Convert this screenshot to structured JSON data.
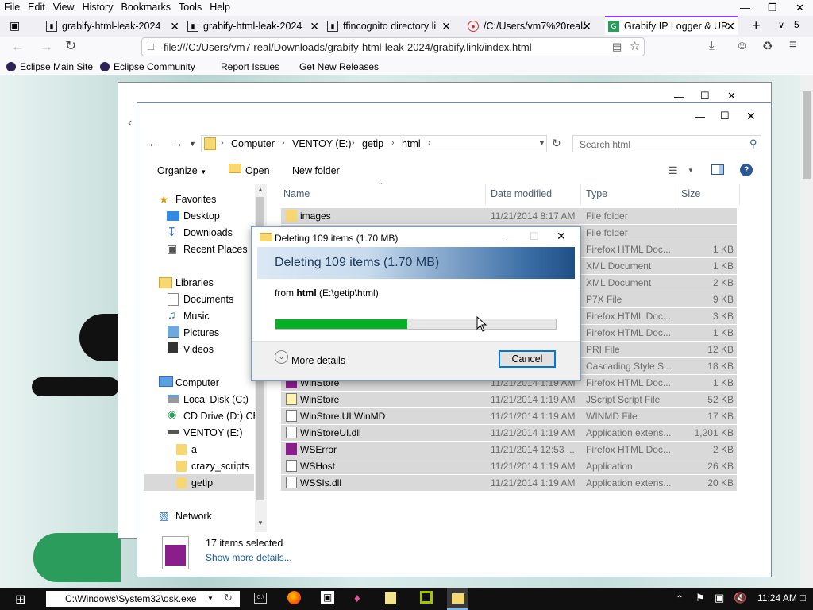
{
  "firefox": {
    "menu": [
      "File",
      "Edit",
      "View",
      "History",
      "Bookmarks",
      "Tools",
      "Help"
    ],
    "tabs": [
      {
        "title": "grabify-html-leak-2024"
      },
      {
        "title": "grabify-html-leak-2024"
      },
      {
        "title": "ffincognito directory li"
      },
      {
        "title": "/C:/Users/vm7%20real/"
      },
      {
        "title": "Grabify IP Logger & UR"
      }
    ],
    "tab_count": "5",
    "url": "file:///C:/Users/vm7 real/Downloads/grabify-html-leak-2024/grabify.link/index.html",
    "bookmarks": [
      "Eclipse Main Site",
      "Eclipse Community",
      "Report Issues",
      "Get New Releases"
    ],
    "accent": "#8f3cff"
  },
  "explorer": {
    "breadcrumb": [
      "Computer",
      "VENTOY (E:)",
      "getip",
      "html"
    ],
    "search_placeholder": "Search html",
    "toolbar": {
      "organize": "Organize",
      "open": "Open",
      "new_folder": "New folder"
    },
    "nav": {
      "favorites": "Favorites",
      "desktop": "Desktop",
      "downloads": "Downloads",
      "recent": "Recent Places",
      "libraries": "Libraries",
      "documents": "Documents",
      "music": "Music",
      "pictures": "Pictures",
      "videos": "Videos",
      "computer": "Computer",
      "local_disk": "Local Disk (C:)",
      "cd_drive": "CD Drive (D:) CEN",
      "ventoy": "VENTOY (E:)",
      "folder_a": "a",
      "folder_crazy": "crazy_scripts",
      "folder_getip": "getip",
      "network": "Network"
    },
    "columns": {
      "name": "Name",
      "date": "Date modified",
      "type": "Type",
      "size": "Size"
    },
    "files": [
      {
        "name": "images",
        "date": "11/21/2014 8:17 AM",
        "type": "File folder",
        "size": ""
      },
      {
        "name": "",
        "date": "",
        "type": "File folder",
        "size": ""
      },
      {
        "name": "",
        "date": "",
        "type": "Firefox HTML Doc...",
        "size": "1 KB"
      },
      {
        "name": "",
        "date": "",
        "type": "XML Document",
        "size": "1 KB"
      },
      {
        "name": "",
        "date": "",
        "type": "XML Document",
        "size": "2 KB"
      },
      {
        "name": "",
        "date": "",
        "type": "P7X File",
        "size": "9 KB"
      },
      {
        "name": "",
        "date": "",
        "type": "Firefox HTML Doc...",
        "size": "3 KB"
      },
      {
        "name": "",
        "date": "",
        "type": "Firefox HTML Doc...",
        "size": "1 KB"
      },
      {
        "name": "",
        "date": "",
        "type": "PRI File",
        "size": "12 KB"
      },
      {
        "name": "",
        "date": "",
        "type": "Cascading Style S...",
        "size": "18 KB"
      },
      {
        "name": "WinStore",
        "date": "11/21/2014 1:19 AM",
        "type": "Firefox HTML Doc...",
        "size": "1 KB"
      },
      {
        "name": "WinStore",
        "date": "11/21/2014 1:19 AM",
        "type": "JScript Script File",
        "size": "52 KB"
      },
      {
        "name": "WinStore.UI.WinMD",
        "date": "11/21/2014 1:19 AM",
        "type": "WINMD File",
        "size": "17 KB"
      },
      {
        "name": "WinStoreUI.dll",
        "date": "11/21/2014 1:19 AM",
        "type": "Application extens...",
        "size": "1,201 KB"
      },
      {
        "name": "WSError",
        "date": "11/21/2014 12:53 ...",
        "type": "Firefox HTML Doc...",
        "size": "2 KB"
      },
      {
        "name": "WSHost",
        "date": "11/21/2014 1:19 AM",
        "type": "Application",
        "size": "26 KB"
      },
      {
        "name": "WSSIs.dll",
        "date": "11/21/2014 1:19 AM",
        "type": "Application extens...",
        "size": "20 KB"
      }
    ],
    "status": {
      "selected": "17 items selected",
      "details_link": "Show more details..."
    }
  },
  "dialog": {
    "title": "Deleting 109 items (1.70 MB)",
    "heading": "Deleting 109 items (1.70 MB)",
    "from_prefix": "from",
    "from_folder": "html",
    "from_path": "(E:\\getip\\html)",
    "progress": 0.47,
    "more_details": "More details",
    "cancel": "Cancel"
  },
  "taskbar": {
    "run_value": "C:\\Windows\\System32\\osk.exe",
    "time": "11:24 AM"
  }
}
